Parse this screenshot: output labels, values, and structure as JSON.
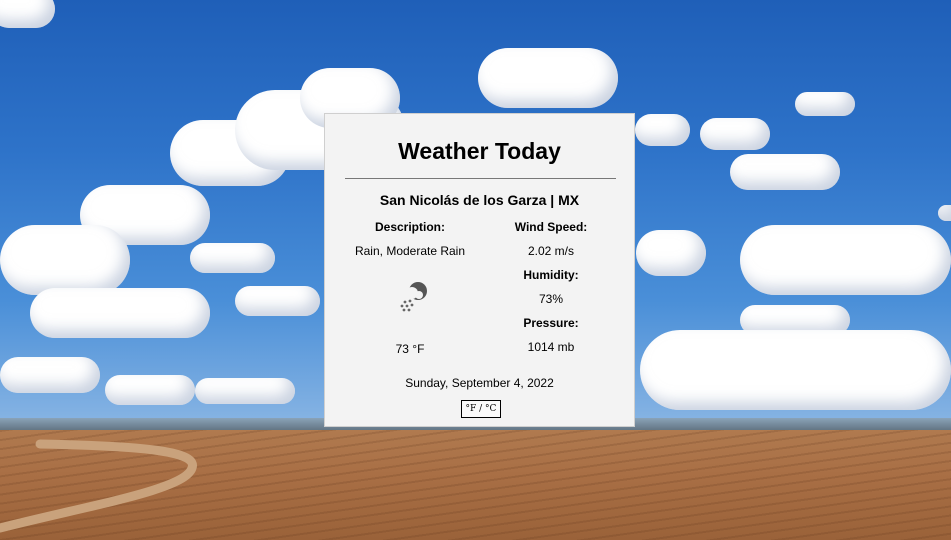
{
  "card": {
    "title": "Weather Today",
    "location": "San Nicolás de los Garza | MX",
    "description_label": "Description:",
    "description_value": "Rain, Moderate Rain",
    "temperature": "73 °F",
    "wind_label": "Wind Speed:",
    "wind_value": "2.02 m/s",
    "humidity_label": "Humidity:",
    "humidity_value": "73%",
    "pressure_label": "Pressure:",
    "pressure_value": "1014 mb",
    "date": "Sunday, September 4, 2022",
    "unit_toggle": "°F / °C",
    "weather_icon": "rain-cloud-icon"
  },
  "colors": {
    "card_background": "#f3f3f3",
    "sky": "#2e73c9",
    "field": "#a96f45"
  }
}
